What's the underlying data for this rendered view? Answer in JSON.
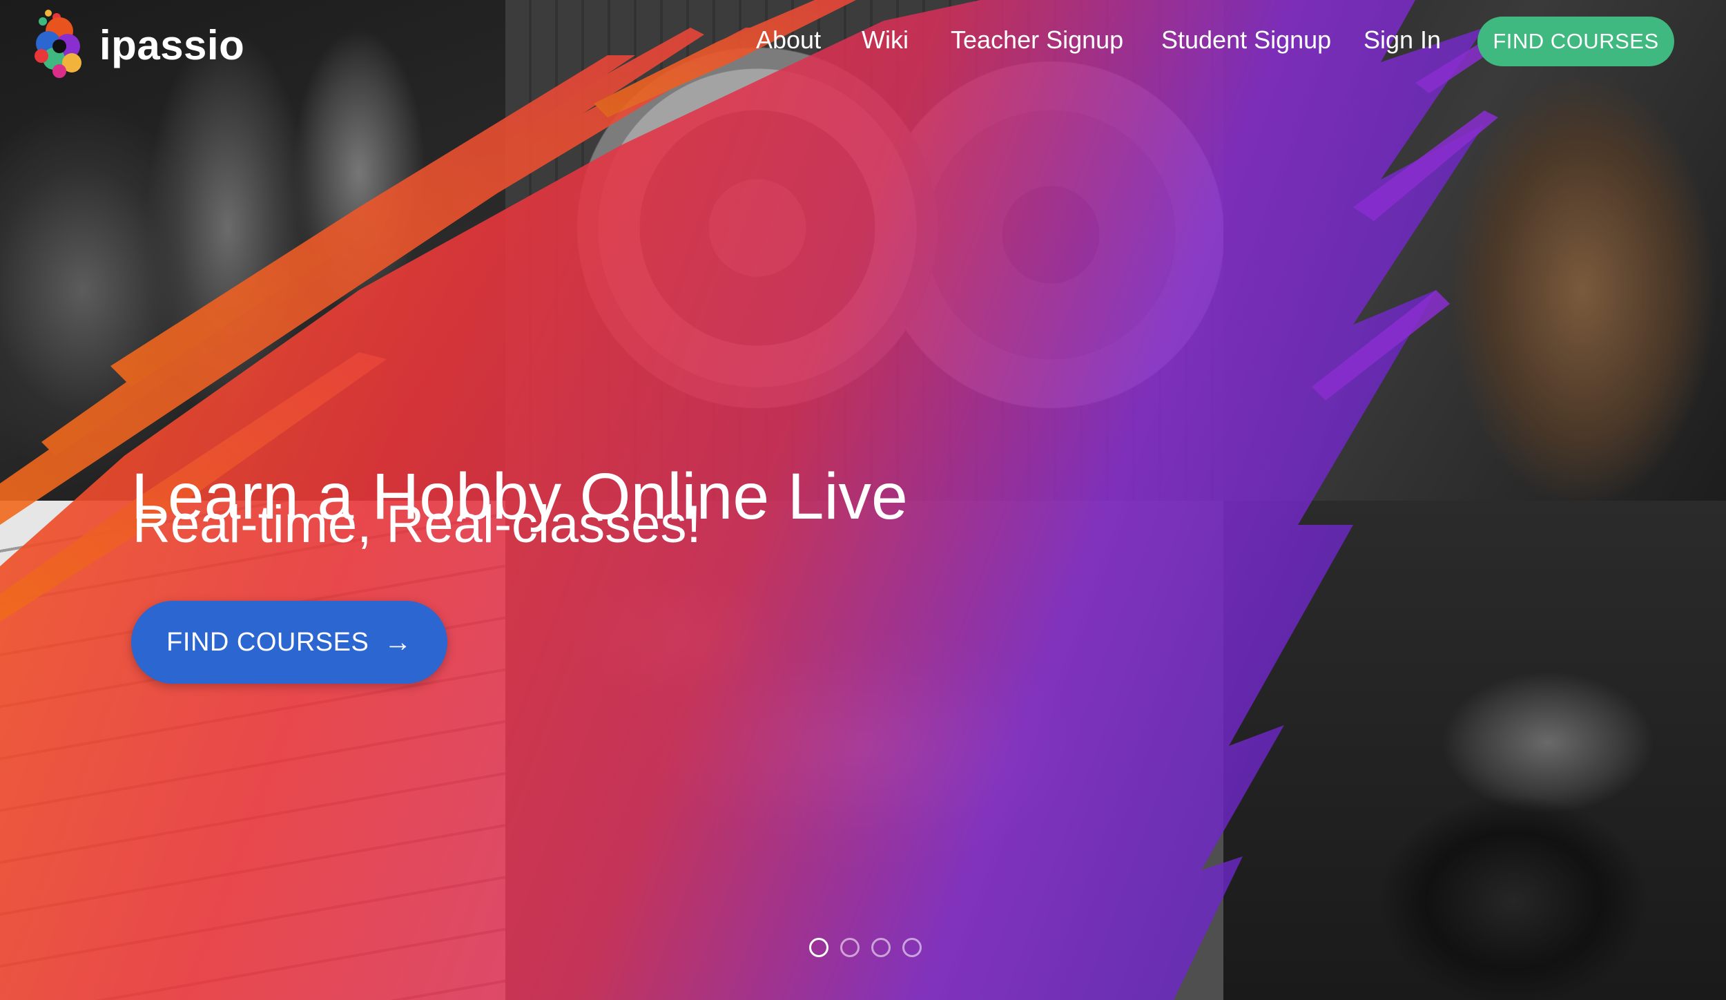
{
  "brand": {
    "name": "ipassio"
  },
  "nav": {
    "links": [
      "About",
      "Wiki",
      "Teacher Signup",
      "Student Signup",
      "Sign In"
    ],
    "cta_label": "FIND COURSES",
    "cta_color": "#3fb980"
  },
  "hero": {
    "headline": "Learn a Hobby Online Live",
    "subheadline": "Real-time, Real-classes!",
    "cta_label": "FIND COURSES",
    "cta_icon": "arrow-right-icon",
    "cta_color": "#2b66d1"
  },
  "carousel": {
    "slide_count": 4,
    "active_index": 0
  },
  "colors": {
    "orange": "#e8531e",
    "red": "#e8373a",
    "purple": "#7a2fd0"
  }
}
